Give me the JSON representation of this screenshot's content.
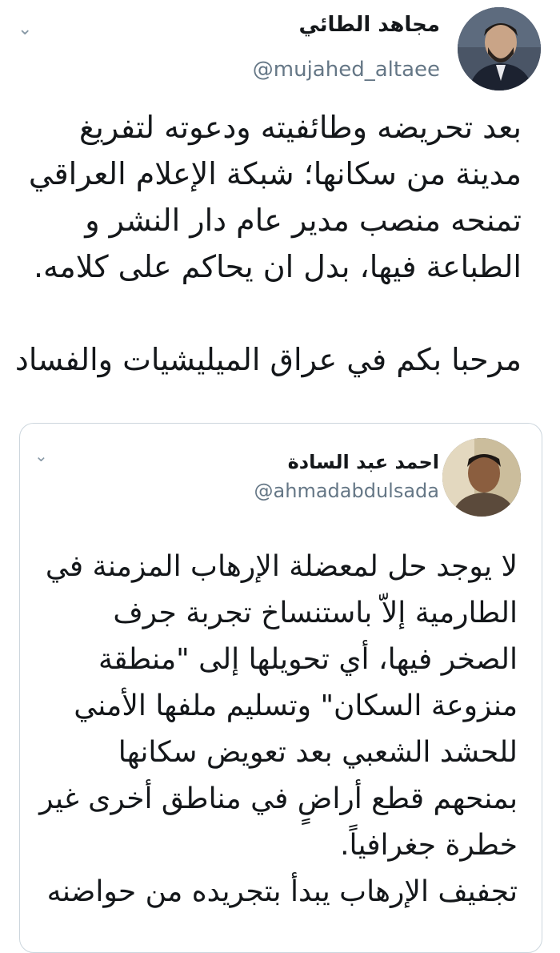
{
  "tweet": {
    "author_name": "مجاهد الطائي",
    "author_handle": "@mujahed_altaee",
    "text_paragraph_1": "بعد تحريضه وطائفيته ودعوته لتفريغ مدينة من سكانها؛ شبكة الإعلام العراقي تمنحه منصب مدير عام دار النشر و الطباعة فيها، بدل ان يحاكم على كلامه.",
    "text_paragraph_2": "مرحبا بكم في عراق الميليشيات والفساد"
  },
  "quoted_tweet": {
    "author_name": "احمد عبد السادة",
    "author_handle": "@ahmadabdulsada",
    "text_paragraph_1": "لا يوجد حل لمعضلة الإرهاب المزمنة في الطارمية إلاّ باستنساخ تجربة جرف الصخر فيها، أي تحويلها إلى \"منطقة منزوعة السكان\" وتسليم ملفها الأمني للحشد الشعبي بعد تعويض سكانها بمنحهم قطع أراضٍ في مناطق أخرى غير خطرة جغرافياً.",
    "text_paragraph_2": "تجفيف الإرهاب يبدأ بتجريده من حواضنه"
  },
  "icons": {
    "menu_chevron": "chevron-down-icon"
  }
}
